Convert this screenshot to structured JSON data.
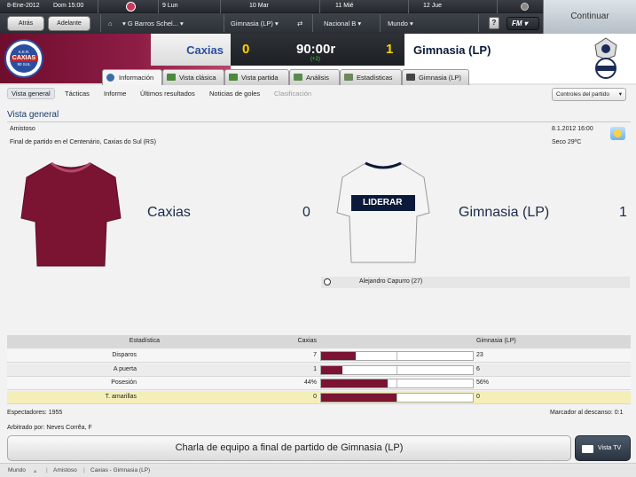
{
  "topbar": {
    "date": "8-Ene-2012",
    "day_time": "Dom  15:00",
    "calendar": [
      {
        "day": "9",
        "label": "Lun"
      },
      {
        "day": "10",
        "label": "Mar"
      },
      {
        "day": "11",
        "label": "Mié"
      },
      {
        "day": "12",
        "label": "Jue"
      }
    ],
    "back_label": "Atrás",
    "forward_label": "Adelante",
    "manager": "G Barros Schel...",
    "team_select": "Gimnasia (LP)",
    "league_select": "Nacional B",
    "world_select": "Mundo",
    "help_label": "?",
    "fm_label": "FM",
    "continue_label": "Continuar"
  },
  "match": {
    "home_team": "Caxias",
    "home_score": "0",
    "time": "90:00r",
    "added_time": "(+2)",
    "away_score": "1",
    "away_team": "Gimnasia (LP)",
    "home_badge_lines": [
      "S.E.R.",
      "CAXIAS",
      "90 SUL"
    ]
  },
  "tabs": [
    {
      "label": "Información",
      "icon": "info-icon"
    },
    {
      "label": "Vista clásica",
      "icon": "pitch-icon"
    },
    {
      "label": "Vista partida",
      "icon": "pitch-icon"
    },
    {
      "label": "Análisis",
      "icon": "analysis-icon"
    },
    {
      "label": "Estadísticas",
      "icon": "stats-icon"
    },
    {
      "label": "Gimnasia (LP)",
      "icon": "team-icon"
    }
  ],
  "subnav": {
    "items": [
      "Vista general",
      "Tácticas",
      "Informe",
      "Últimos resultados",
      "Noticias de goles",
      "Clasificación"
    ],
    "controls_label": "Controles del partido"
  },
  "overview": {
    "title": "Vista general",
    "competition": "Amistoso",
    "description": "Final de partido en el Centenário, Caxias do Sul (RS)",
    "datetime": "8.1.2012 16:00",
    "weather": "Seco 29ºC",
    "home_team": "Caxias",
    "home_score": "0",
    "away_team": "Gimnasia (LP)",
    "away_score": "1",
    "away_sponsor": "LIDERAR",
    "scorer": "Alejandro Capurro (27)"
  },
  "stats": {
    "header": [
      "Estadística",
      "Caxias",
      "Gimnasia (LP)"
    ],
    "rows": [
      {
        "label": "Disparos",
        "home": "7",
        "away": "23",
        "home_frac": 0.23
      },
      {
        "label": "A puerta",
        "home": "1",
        "away": "6",
        "home_frac": 0.14
      },
      {
        "label": "Posesión",
        "home": "44%",
        "away": "56%",
        "home_frac": 0.44
      },
      {
        "label": "T. amarillas",
        "home": "0",
        "away": "0",
        "home_frac": 0.5
      }
    ]
  },
  "info": {
    "attendance": "Espectadores: 1955",
    "halftime": "Marcador al descanso: 0:1",
    "referee": "Arbitrado por: Neves Corrêa, F"
  },
  "actions": {
    "team_talk": "Charla de equipo a final de partido de Gimnasia (LP)",
    "tv_label": "Vista TV"
  },
  "footer": {
    "crumbs": [
      "Mundo",
      "Amistoso",
      "Caxias - Gimnasia (LP)"
    ]
  },
  "colors": {
    "home_primary": "#7a1432",
    "accent_score": "#ffd400"
  }
}
